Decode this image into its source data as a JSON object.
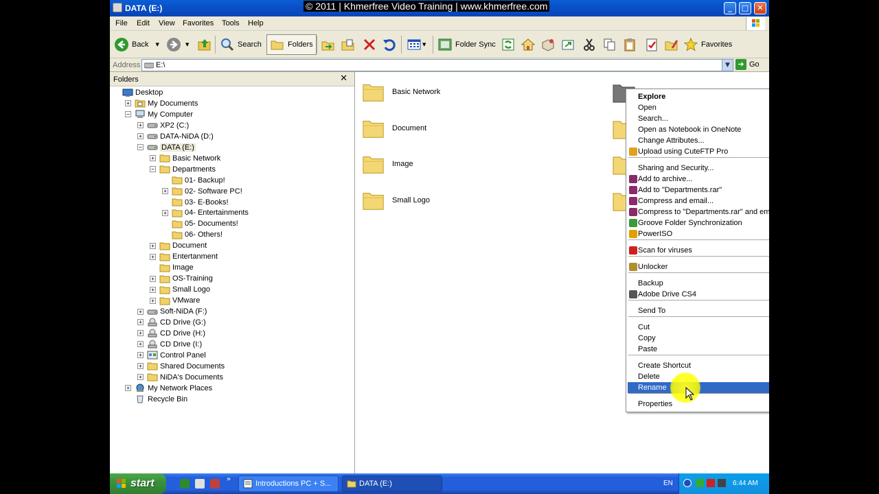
{
  "window": {
    "title": "DATA (E:)",
    "watermark": "© 2011 | Khmerfree Video Training | www.khmerfree.com",
    "controls": {
      "minimize": "_",
      "maximize": "□",
      "close": "✕"
    }
  },
  "menu": [
    "File",
    "Edit",
    "View",
    "Favorites",
    "Tools",
    "Help"
  ],
  "toolbar": {
    "back": "Back",
    "search": "Search",
    "folders": "Folders",
    "folder_sync": "Folder Sync",
    "favorites": "Favorites"
  },
  "address": {
    "label": "Address",
    "value": "E:\\",
    "go": "Go"
  },
  "folder_pane": {
    "title": "Folders",
    "close": "✕",
    "tree": [
      {
        "label": "Desktop",
        "icon": "desktop-icon",
        "expander": ""
      },
      {
        "label": "My Documents",
        "icon": "my-documents-icon",
        "expander": "+"
      },
      {
        "label": "My Computer",
        "icon": "my-computer-icon",
        "expander": "−"
      },
      {
        "label": "XP2 (C:)",
        "icon": "drive-icon",
        "expander": "+"
      },
      {
        "label": "DATA-NiDA (D:)",
        "icon": "drive-icon",
        "expander": "+"
      },
      {
        "label": "DATA (E:)",
        "icon": "drive-icon",
        "expander": "−"
      },
      {
        "label": "Basic Network",
        "icon": "folder-icon",
        "expander": "+"
      },
      {
        "label": "Departments",
        "icon": "folder-icon",
        "expander": "−"
      },
      {
        "label": "01- Backup!",
        "icon": "folder-icon",
        "expander": ""
      },
      {
        "label": "02- Software PC!",
        "icon": "folder-icon",
        "expander": "+"
      },
      {
        "label": "03- E-Books!",
        "icon": "folder-icon",
        "expander": ""
      },
      {
        "label": "04- Entertainments",
        "icon": "folder-icon",
        "expander": "+"
      },
      {
        "label": "05- Documents!",
        "icon": "folder-icon",
        "expander": ""
      },
      {
        "label": "06- Others!",
        "icon": "folder-icon",
        "expander": ""
      },
      {
        "label": "Document",
        "icon": "folder-icon",
        "expander": "+"
      },
      {
        "label": "Entertanment",
        "icon": "folder-icon",
        "expander": "+"
      },
      {
        "label": "Image",
        "icon": "folder-icon",
        "expander": ""
      },
      {
        "label": "OS-Training",
        "icon": "folder-icon",
        "expander": "+"
      },
      {
        "label": "Small Logo",
        "icon": "folder-icon",
        "expander": "+"
      },
      {
        "label": "VMware",
        "icon": "folder-icon",
        "expander": "+"
      },
      {
        "label": "Soft-NiDA (F:)",
        "icon": "drive-icon",
        "expander": "+"
      },
      {
        "label": "CD Drive (G:)",
        "icon": "cd-drive-icon",
        "expander": "+"
      },
      {
        "label": "CD Drive (H:)",
        "icon": "cd-drive-icon",
        "expander": "+"
      },
      {
        "label": "CD Drive (I:)",
        "icon": "cd-drive-icon",
        "expander": "+"
      },
      {
        "label": "Control Panel",
        "icon": "control-panel-icon",
        "expander": "+"
      },
      {
        "label": "Shared Documents",
        "icon": "folder-icon",
        "expander": "+"
      },
      {
        "label": "NiDA's Documents",
        "icon": "folder-icon",
        "expander": "+"
      },
      {
        "label": "My Network Places",
        "icon": "network-places-icon",
        "expander": "+"
      },
      {
        "label": "Recycle Bin",
        "icon": "recycle-bin-icon",
        "expander": ""
      }
    ]
  },
  "content": {
    "items": [
      {
        "label": "Basic Network"
      },
      {
        "label": "Document"
      },
      {
        "label": "Image"
      },
      {
        "label": "Small Logo"
      }
    ]
  },
  "context_menu": {
    "items": [
      {
        "label": "Explore",
        "bold": true
      },
      {
        "label": "Open"
      },
      {
        "label": "Search..."
      },
      {
        "label": "Open as Notebook in OneNote"
      },
      {
        "label": "Change Attributes..."
      },
      {
        "label": "Upload using CuteFTP Pro",
        "icon": "cuteftp-icon",
        "submenu": true
      },
      {
        "label": "Sharing and Security..."
      },
      {
        "label": "Add to archive...",
        "icon": "winrar-icon"
      },
      {
        "label": "Add to \"Departments.rar\"",
        "icon": "winrar-icon"
      },
      {
        "label": "Compress and email...",
        "icon": "winrar-icon"
      },
      {
        "label": "Compress to \"Departments.rar\" and email",
        "icon": "winrar-icon"
      },
      {
        "label": "Groove Folder Synchronization",
        "icon": "groove-icon",
        "submenu": true
      },
      {
        "label": "PowerISO",
        "icon": "poweriso-icon",
        "submenu": true
      },
      {
        "label": "Scan for viruses",
        "icon": "kaspersky-icon"
      },
      {
        "label": "Unlocker",
        "icon": "unlocker-icon"
      },
      {
        "label": "Backup"
      },
      {
        "label": "Adobe Drive CS4",
        "icon": "adobe-drive-icon",
        "submenu": true
      },
      {
        "label": "Send To",
        "submenu": true
      },
      {
        "label": "Cut"
      },
      {
        "label": "Copy"
      },
      {
        "label": "Paste"
      },
      {
        "label": "Create Shortcut"
      },
      {
        "label": "Delete"
      },
      {
        "label": "Rename",
        "highlighted": true
      },
      {
        "label": "Properties"
      }
    ],
    "submenu_arrow": "▶"
  },
  "taskbar": {
    "start": "start",
    "tasks": [
      {
        "label": "Introductions PC + S..."
      },
      {
        "label": "DATA (E:)"
      }
    ],
    "tray": {
      "lang": "EN",
      "clock": "6:44 AM"
    },
    "quicklaunch_more": "»"
  },
  "colors": {
    "title_bar": "#0a50c8",
    "menu_highlight": "#316ac5",
    "taskbar": "#245edb",
    "start_button": "#3c913c",
    "tray": "#1290e0"
  }
}
